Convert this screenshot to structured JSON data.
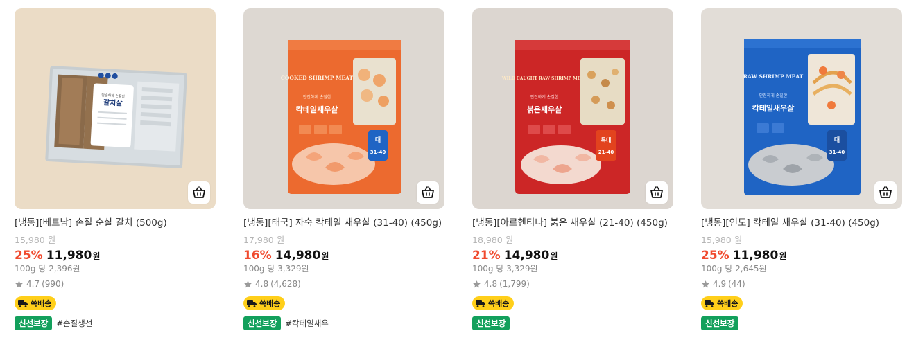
{
  "products": [
    {
      "name": "[냉동][베트남] 손질 순살 갈치 (500g)",
      "original_price": "15,980 원",
      "discount": "25%",
      "price": "11,980",
      "currency": "원",
      "unit_price": "100g 당 2,396원",
      "rating": "4.7",
      "review_count": "(990)",
      "delivery_badge": "쓱배송",
      "fresh_badge": "신선보장",
      "hashtag": "#손질생선",
      "package_label": "갈치살",
      "package_subtitle": "단순하게 손질한",
      "bg_color": "#ebdcc6",
      "package_color": "#b8c0c6"
    },
    {
      "name": "[냉동][태국] 자숙 칵테일 새우살 (31-40) (450g)",
      "original_price": "17,980 원",
      "discount": "16%",
      "price": "14,980",
      "currency": "원",
      "unit_price": "100g 당 3,329원",
      "rating": "4.8",
      "review_count": "(4,628)",
      "delivery_badge": "쓱배송",
      "fresh_badge": "신선보장",
      "hashtag": "#칵테일새우",
      "package_label": "칵테일새우살",
      "package_subtitle": "안전하게 손질한",
      "package_english": "COOKED SHRIMP MEAT",
      "size_badge": "31-40",
      "size_badge_top": "대",
      "bg_color": "#ddd8d2",
      "package_color": "#ec6a2f"
    },
    {
      "name": "[냉동][아르헨티나] 붉은 새우살 (21-40) (450g)",
      "original_price": "18,980 원",
      "discount": "21%",
      "price": "14,980",
      "currency": "원",
      "unit_price": "100g 당 3,329원",
      "rating": "4.8",
      "review_count": "(1,799)",
      "delivery_badge": "쓱배송",
      "fresh_badge": "신선보장",
      "hashtag": "",
      "package_label": "붉은새우살",
      "package_subtitle": "안전하게 손질한",
      "package_english": "WILD CAUGHT RAW SHRIMP MEAT",
      "size_badge": "21-40",
      "size_badge_top": "특대",
      "bg_color": "#dcd6d0",
      "package_color": "#cc2626"
    },
    {
      "name": "[냉동][인도] 칵테일 새우살 (31-40) (450g)",
      "original_price": "15,980 원",
      "discount": "25%",
      "price": "11,980",
      "currency": "원",
      "unit_price": "100g 당 2,645원",
      "rating": "4.9",
      "review_count": "(44)",
      "delivery_badge": "쓱배송",
      "fresh_badge": "신선보장",
      "hashtag": "",
      "package_label": "칵테일새우살",
      "package_subtitle": "안전하게 손질한",
      "package_english": "RAW SHRIMP MEAT",
      "size_badge": "31-40",
      "size_badge_top": "대",
      "bg_color": "#e2ddd7",
      "package_color": "#1f64c4"
    }
  ],
  "icons": {
    "cart": "shopping-basket-icon",
    "star": "star-icon",
    "truck": "delivery-truck-icon"
  }
}
